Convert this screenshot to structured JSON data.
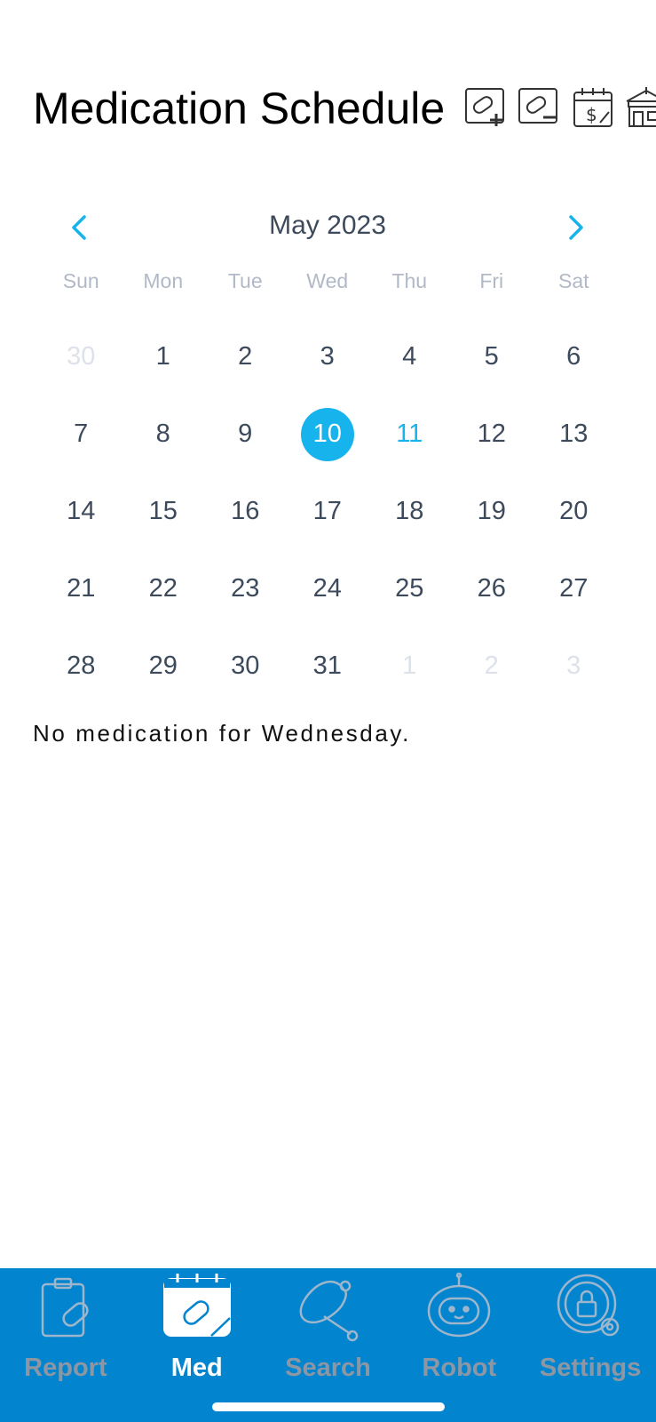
{
  "header": {
    "title": "Medication Schedule",
    "icons": [
      "add-medication-icon",
      "remove-medication-icon",
      "billing-calendar-icon",
      "pharmacy-icon"
    ]
  },
  "calendar": {
    "month_label": "May 2023",
    "prev_icon": "chevron-left-icon",
    "next_icon": "chevron-right-icon",
    "weekdays": [
      "Sun",
      "Mon",
      "Tue",
      "Wed",
      "Thu",
      "Fri",
      "Sat"
    ],
    "weeks": [
      [
        "30",
        "1",
        "2",
        "3",
        "4",
        "5",
        "6"
      ],
      [
        "7",
        "8",
        "9",
        "10",
        "11",
        "12",
        "13"
      ],
      [
        "14",
        "15",
        "16",
        "17",
        "18",
        "19",
        "20"
      ],
      [
        "21",
        "22",
        "23",
        "24",
        "25",
        "26",
        "27"
      ],
      [
        "28",
        "29",
        "30",
        "31",
        "1",
        "2",
        "3"
      ]
    ],
    "selected_day": "10",
    "today": "11",
    "accent_color": "#17b3ec"
  },
  "message": "No medication for Wednesday.",
  "tabbar": {
    "background": "#0284cf",
    "tabs": [
      {
        "label": "Report",
        "icon": "clipboard-pill-icon",
        "active": false
      },
      {
        "label": "Med",
        "icon": "calendar-pill-icon",
        "active": true
      },
      {
        "label": "Search",
        "icon": "stethoscope-icon",
        "active": false
      },
      {
        "label": "Robot",
        "icon": "robot-icon",
        "active": false
      },
      {
        "label": "Settings",
        "icon": "lock-gear-icon",
        "active": false
      }
    ]
  }
}
